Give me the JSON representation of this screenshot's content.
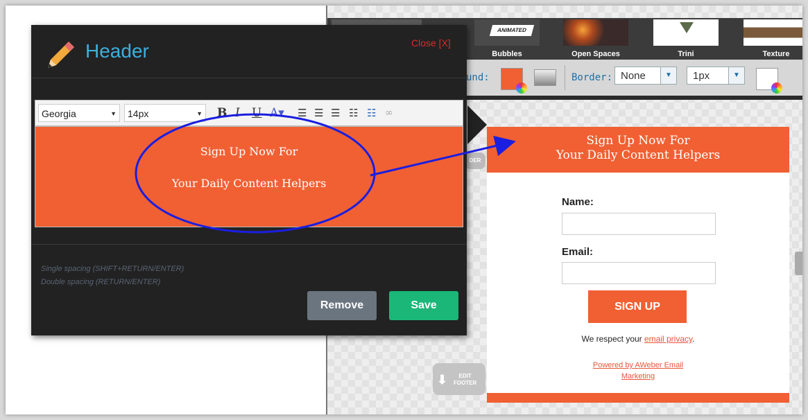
{
  "themes": [
    {
      "label": "",
      "badge": ""
    },
    {
      "label": "Bubbles",
      "badge": "ANIMATED"
    },
    {
      "label": "Open Spaces",
      "badge": ""
    },
    {
      "label": "Trini",
      "badge": ""
    },
    {
      "label": "Texture",
      "badge": ""
    }
  ],
  "style_toolbar": {
    "background_label": "und:",
    "border_label": "Border:",
    "border_style": "None",
    "border_width": "1px",
    "background_color": "#f06033"
  },
  "edit_tags": {
    "header": "DER",
    "footer_line1": "EDIT",
    "footer_line2": "FOOTER"
  },
  "form": {
    "header_line1": "Sign Up Now For",
    "header_line2": "Your Daily Content Helpers",
    "name_label": "Name:",
    "email_label": "Email:",
    "submit_label": "SIGN UP",
    "respect_text": "We respect your ",
    "privacy_link": "email privacy",
    "respect_end": ".",
    "powered_line1": "Powered by AWeber Email",
    "powered_line2": "Marketing",
    "accent": "#f06033"
  },
  "modal": {
    "title": "Header",
    "close_label": "Close [X]",
    "font_family": "Georgia",
    "font_size": "14px",
    "content_line1": "Sign Up Now For",
    "content_line2": "Your Daily Content Helpers",
    "hint1": "Single spacing (SHIFT+RETURN/ENTER)",
    "hint2": "Double spacing (RETURN/ENTER)",
    "remove_label": "Remove",
    "save_label": "Save",
    "title_color": "#3bb0e0",
    "save_color": "#1ab778"
  },
  "icons": [
    "pencil-icon",
    "bold-icon",
    "italic-icon",
    "underline-icon",
    "font-color-icon",
    "align-left-icon",
    "align-center-icon",
    "align-right-icon",
    "bullet-list-icon",
    "numbered-list-icon",
    "link-icon",
    "color-wheel-icon",
    "down-arrow-icon"
  ]
}
